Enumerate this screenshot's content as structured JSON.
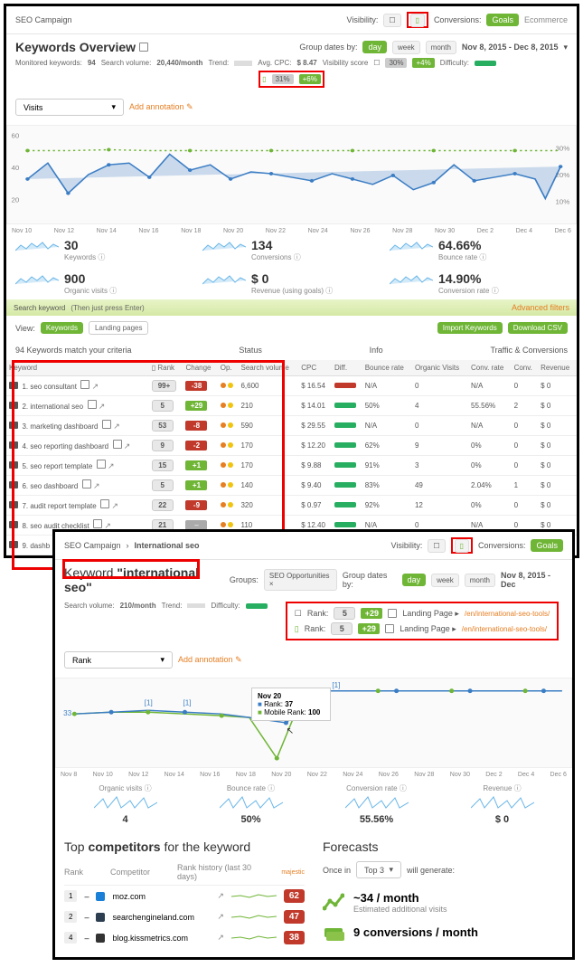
{
  "top": {
    "campaign": "SEO Campaign",
    "visibility_label": "Visibility:",
    "conversions_label": "Conversions:",
    "goals_btn": "Goals",
    "ecom_btn": "Ecommerce"
  },
  "overview": {
    "title": "Keywords Overview",
    "mon_kw_lbl": "Monitored keywords:",
    "mon_kw_val": "94",
    "sv_lbl": "Search volume:",
    "sv_val": "20,440/month",
    "trend_lbl": "Trend:",
    "cpc_lbl": "Avg. CPC: ",
    "cpc_val": "$ 8.47",
    "vs_lbl": "Visibility score",
    "vs_desktop": "30%",
    "vs_desktop_chg": "+4%",
    "vs_mobile": "31%",
    "vs_mobile_chg": "+6%",
    "diff_lbl": "Difficulty:",
    "group_lbl": "Group dates by:",
    "group_day": "day",
    "group_week": "week",
    "group_month": "month",
    "date_range": "Nov 8, 2015 - Dec 8, 2015",
    "dropdown": "Visits",
    "add_ann": "Add annotation"
  },
  "chart_data": {
    "type": "line",
    "x": [
      "Nov 10",
      "Nov 12",
      "Nov 14",
      "Nov 16",
      "Nov 18",
      "Nov 20",
      "Nov 22",
      "Nov 24",
      "Nov 26",
      "Nov 28",
      "Nov 30",
      "Dec 2",
      "Dec 4",
      "Dec 6"
    ],
    "series": [
      {
        "name": "Visits",
        "values": [
          32,
          48,
          25,
          40,
          50,
          52,
          38,
          58,
          42,
          48,
          37,
          42,
          40,
          38,
          35,
          40,
          36,
          34,
          40,
          32,
          36,
          45,
          35,
          38,
          40,
          36,
          26,
          44
        ],
        "color": "#3b7dc4",
        "fill": true
      },
      {
        "name": "Visibility",
        "values": [
          30,
          30,
          30,
          30,
          31,
          30,
          30,
          30,
          30,
          30,
          30,
          30,
          30,
          30,
          30,
          30,
          30,
          30,
          30,
          30,
          30,
          30,
          30,
          30,
          30,
          30,
          30,
          30
        ],
        "color": "#6fb536",
        "dashed": true
      }
    ],
    "yleft": [
      60,
      40,
      20
    ],
    "yright": [
      "30%",
      "20%",
      "10%"
    ]
  },
  "stats": [
    {
      "val": "30",
      "lbl": "Keywords"
    },
    {
      "val": "134",
      "lbl": "Conversions"
    },
    {
      "val": "64.66%",
      "lbl": "Bounce rate"
    },
    {
      "val": "900",
      "lbl": "Organic visits"
    },
    {
      "val": "$ 0",
      "lbl": "Revenue (using goals)"
    },
    {
      "val": "14.90%",
      "lbl": "Conversion rate"
    }
  ],
  "search": {
    "placeholder": "Search keyword",
    "hint": "(Then just press Enter)",
    "adv": "Advanced filters"
  },
  "view": {
    "lbl": "View:",
    "kw": "Keywords",
    "lp": "Landing pages",
    "import": "Import Keywords",
    "dlcsv": "Download CSV",
    "match": "94 Keywords match your criteria",
    "status": "Status",
    "info": "Info",
    "traffic": "Traffic & Conversions"
  },
  "table": {
    "headers": [
      "Keyword",
      "Rank",
      "Change",
      "Op.",
      "Search volume",
      "CPC",
      "Diff.",
      "Bounce rate",
      "Organic Visits",
      "Conv. rate",
      "Conv.",
      "Revenue"
    ],
    "rows": [
      {
        "kw": "1. seo consultant",
        "rank": "99+",
        "chg": "-38",
        "chgc": "r",
        "sv": "6,600",
        "cpc": "$ 16.54",
        "diff": "r",
        "br": "N/A",
        "ov": "0",
        "cr": "N/A",
        "cv": "0",
        "rev": "$ 0"
      },
      {
        "kw": "2. international seo",
        "rank": "5",
        "chg": "+29",
        "chgc": "g",
        "sv": "210",
        "cpc": "$ 14.01",
        "diff": "g",
        "br": "50%",
        "ov": "4",
        "cr": "55.56%",
        "cv": "2",
        "rev": "$ 0"
      },
      {
        "kw": "3. marketing dashboard",
        "rank": "53",
        "chg": "-8",
        "chgc": "r",
        "sv": "590",
        "cpc": "$ 29.55",
        "diff": "g",
        "br": "N/A",
        "ov": "0",
        "cr": "N/A",
        "cv": "0",
        "rev": "$ 0"
      },
      {
        "kw": "4. seo reporting dashboard",
        "rank": "9",
        "chg": "-2",
        "chgc": "r",
        "sv": "170",
        "cpc": "$ 12.20",
        "diff": "g",
        "br": "62%",
        "ov": "9",
        "cr": "0%",
        "cv": "0",
        "rev": "$ 0"
      },
      {
        "kw": "5. seo report template",
        "rank": "15",
        "chg": "+1",
        "chgc": "g",
        "sv": "170",
        "cpc": "$ 9.88",
        "diff": "g",
        "br": "91%",
        "ov": "3",
        "cr": "0%",
        "cv": "0",
        "rev": "$ 0"
      },
      {
        "kw": "6. seo dashboard",
        "rank": "5",
        "chg": "+1",
        "chgc": "g",
        "sv": "140",
        "cpc": "$ 9.40",
        "diff": "g",
        "br": "83%",
        "ov": "49",
        "cr": "2.04%",
        "cv": "1",
        "rev": "$ 0"
      },
      {
        "kw": "7. audit report template",
        "rank": "22",
        "chg": "-9",
        "chgc": "r",
        "sv": "320",
        "cpc": "$ 0.97",
        "diff": "g",
        "br": "92%",
        "ov": "12",
        "cr": "0%",
        "cv": "0",
        "rev": "$ 0"
      },
      {
        "kw": "8. seo audit checklist",
        "rank": "21",
        "chg": "–",
        "chgc": "x",
        "sv": "110",
        "cpc": "$ 12.40",
        "diff": "g",
        "br": "N/A",
        "ov": "0",
        "cr": "N/A",
        "cv": "0",
        "rev": "$ 0"
      },
      {
        "kw": "9. dashb",
        "rank": "",
        "chg": "",
        "chgc": "",
        "sv": "",
        "cpc": "",
        "diff": "",
        "br": "",
        "ov": "",
        "cr": "",
        "cv": "",
        "rev": ""
      }
    ],
    "rank_icon": "Rank"
  },
  "detail": {
    "bc1": "SEO Campaign",
    "bc2": "International seo",
    "visibility_label": "Visibility:",
    "conversions_label": "Conversions:",
    "goals": "Goals",
    "title_prefix": "Keyword ",
    "title_kw": "\"international seo\"",
    "groups_lbl": "Groups:",
    "group_tag": "SEO Opportunities",
    "group_lbl": "Group dates by:",
    "day": "day",
    "week": "week",
    "month": "month",
    "date": "Nov 8, 2015 - Dec",
    "sv_lbl": "Search volume:",
    "sv_val": "210/month",
    "trend_lbl": "Trend:",
    "diff_lbl": "Difficulty:",
    "rank_d_lbl": "Rank:",
    "rank_d_val": "5",
    "rank_d_chg": "+29",
    "rank_m_lbl": "Rank:",
    "rank_m_val": "5",
    "rank_m_chg": "+29",
    "lp_lbl": "Landing Page ▸",
    "lp_url": "/en/international-seo-tools/",
    "dropdown": "Rank",
    "add_ann": "Add annotation",
    "tooltip_date": "Nov 20",
    "tooltip_rank_lbl": "Rank:",
    "tooltip_rank": "37",
    "tooltip_mrank_lbl": "Mobile Rank:",
    "tooltip_mrank": "100",
    "chart_note_1": "[1]",
    "chart_note_2": "[1]",
    "chart_note_3": "[1]",
    "start_val": "33"
  },
  "chart_data_detail": {
    "type": "line",
    "x": [
      "Nov 8",
      "Nov 10",
      "Nov 12",
      "Nov 14",
      "Nov 16",
      "Nov 18",
      "Nov 20",
      "Nov 22",
      "Nov 24",
      "Nov 26",
      "Nov 28",
      "Nov 30",
      "Dec 2",
      "Dec 4",
      "Dec 6"
    ],
    "series": [
      {
        "name": "Desktop Rank",
        "values": [
          33,
          32,
          32,
          32,
          33,
          34,
          37,
          5,
          5,
          5,
          5,
          5,
          5,
          5,
          5
        ],
        "color": "#3b7dc4"
      },
      {
        "name": "Mobile Rank",
        "values": [
          33,
          33,
          33,
          33,
          33,
          33,
          100,
          5,
          5,
          5,
          5,
          5,
          5,
          5,
          5
        ],
        "color": "#6fb536"
      }
    ]
  },
  "mini": [
    {
      "lbl": "Organic visits",
      "val": "4"
    },
    {
      "lbl": "Bounce rate",
      "val": "50%"
    },
    {
      "lbl": "Conversion rate",
      "val": "55.56%"
    },
    {
      "lbl": "Revenue",
      "val": "$ 0"
    }
  ],
  "comp": {
    "title": "Top competitors for the keyword",
    "hdr_rank": "Rank",
    "hdr_comp": "Competitor",
    "hdr_hist": "Rank history (last 30 days)",
    "majestic": "majestic",
    "rows": [
      {
        "rank": "1",
        "fav": "#1a7fd6",
        "site": "moz.com",
        "score": "62"
      },
      {
        "rank": "2",
        "fav": "#2c3e50",
        "site": "searchengineland.com",
        "score": "47"
      },
      {
        "rank": "4",
        "fav": "#333",
        "site": "blog.kissmetrics.com",
        "score": "38"
      }
    ]
  },
  "forecast": {
    "title": "Forecasts",
    "once_in": "Once in",
    "sel": "Top 3",
    "gen": "will generate:",
    "f1_val": "~34 / month",
    "f1_lbl": "Estimated additional visits",
    "f2_val": "9 conversions / month"
  }
}
